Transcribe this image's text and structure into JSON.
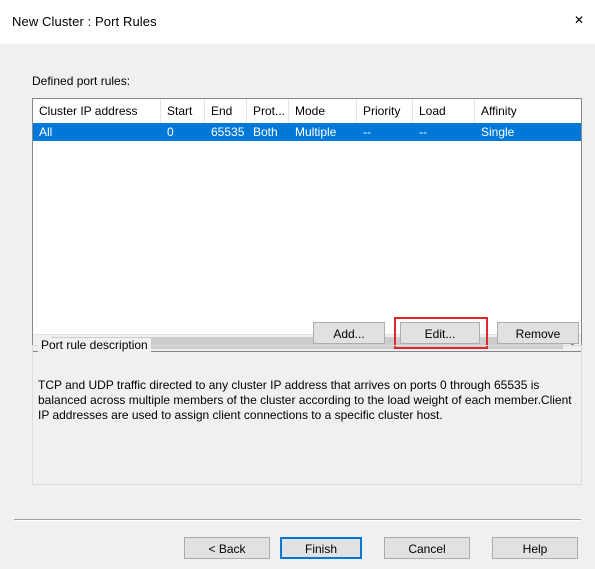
{
  "window": {
    "title": "New Cluster : Port Rules",
    "close_glyph": "✕"
  },
  "port_rules": {
    "label": "Defined port rules:",
    "columns": [
      "Cluster IP address",
      "Start",
      "End",
      "Prot...",
      "Mode",
      "Priority",
      "Load",
      "Affinity"
    ],
    "rows": [
      [
        "All",
        "0",
        "65535",
        "Both",
        "Multiple",
        "--",
        "--",
        "Single"
      ]
    ],
    "selected_row": 0,
    "scroll_left_glyph": "<",
    "scroll_right_glyph": ">"
  },
  "buttons": {
    "add": "Add...",
    "edit": "Edit...",
    "remove": "Remove",
    "back": "< Back",
    "finish": "Finish",
    "cancel": "Cancel",
    "help": "Help"
  },
  "description": {
    "label": "Port rule description",
    "text": "TCP and UDP traffic directed to any cluster IP address that arrives on ports 0 through 65535 is balanced across multiple members of the cluster according to the load weight of each member.Client IP addresses are used to assign client connections to a specific cluster host."
  },
  "colors": {
    "selection": "#0078d7",
    "highlight_box": "#e0252c"
  },
  "icons": {
    "close": "close-icon",
    "scroll_left": "chevron-left-icon",
    "scroll_right": "chevron-right-icon"
  }
}
